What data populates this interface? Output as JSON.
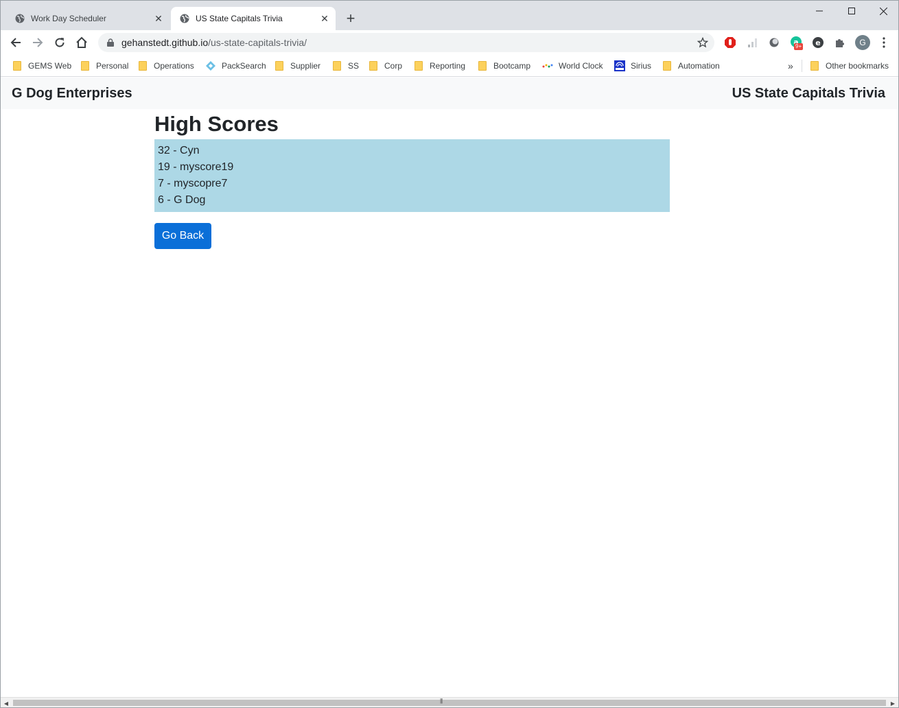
{
  "browser": {
    "tabs": [
      {
        "title": "Work Day Scheduler",
        "active": false
      },
      {
        "title": "US State Capitals Trivia",
        "active": true
      }
    ],
    "url_host": "gehanstedt.github.io",
    "url_path": "/us-state-capitals-trivia/",
    "profile_initial": "G",
    "ext_badge": "9+",
    "bookmarks": [
      {
        "label": "GEMS Web",
        "icon": "folder-icon"
      },
      {
        "label": "Personal",
        "icon": "folder-icon"
      },
      {
        "label": "Operations",
        "icon": "folder-icon"
      },
      {
        "label": "PackSearch",
        "icon": "packsearch-icon"
      },
      {
        "label": "Supplier",
        "icon": "folder-icon"
      },
      {
        "label": "SS",
        "icon": "folder-icon"
      },
      {
        "label": "Corp",
        "icon": "folder-icon"
      },
      {
        "label": "Reporting",
        "icon": "folder-icon"
      },
      {
        "label": "Bootcamp",
        "icon": "folder-icon"
      },
      {
        "label": "World Clock",
        "icon": "dots-icon"
      },
      {
        "label": "Sirius",
        "icon": "sirius-icon"
      },
      {
        "label": "Automation",
        "icon": "folder-icon"
      }
    ],
    "overflow": "»",
    "other_bookmarks": "Other bookmarks"
  },
  "page": {
    "brand": "G Dog Enterprises",
    "app_title": "US State Capitals Trivia",
    "heading": "High Scores",
    "scores": [
      "32 - Cyn",
      "19 - myscore19",
      "7 - myscopre7",
      "6 - G Dog"
    ],
    "go_back": "Go Back"
  },
  "colors": {
    "score_bg": "#add8e6",
    "button_bg": "#0a6fd8",
    "navbar_bg": "#f8f9fa"
  }
}
